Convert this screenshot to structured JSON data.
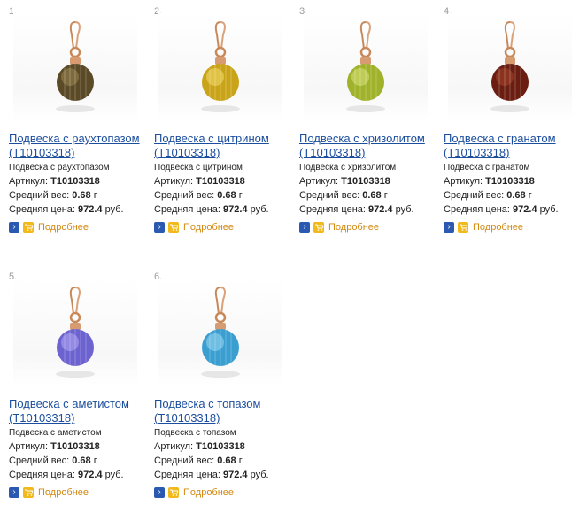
{
  "labels": {
    "article": "Артикул:",
    "weight": "Средний вес:",
    "price": "Средняя цена:",
    "more": "Подробнее"
  },
  "products": [
    {
      "num": "1.",
      "title": "Подвеска с раухтопазом (T10103318)",
      "desc": "Подвеска с раухтопазом",
      "article": "T10103318",
      "weight": "0.68",
      "weight_unit": "г",
      "price": "972.4",
      "currency": "руб.",
      "stone_color": "#5b4a26",
      "stone_light": "#9a8650"
    },
    {
      "num": "2.",
      "title": "Подвеска с цитрином (T10103318)",
      "desc": "Подвеска с цитрином",
      "article": "T10103318",
      "weight": "0.68",
      "weight_unit": "г",
      "price": "972.4",
      "currency": "руб.",
      "stone_color": "#c9a418",
      "stone_light": "#f2dc6a"
    },
    {
      "num": "3.",
      "title": "Подвеска с хризолитом (T10103318)",
      "desc": "Подвеска с хризолитом",
      "article": "T10103318",
      "weight": "0.68",
      "weight_unit": "г",
      "price": "972.4",
      "currency": "руб.",
      "stone_color": "#9fb22a",
      "stone_light": "#d8e47c"
    },
    {
      "num": "4.",
      "title": "Подвеска с гранатом (T10103318)",
      "desc": "Подвеска с гранатом",
      "article": "T10103318",
      "weight": "0.68",
      "weight_unit": "г",
      "price": "972.4",
      "currency": "руб.",
      "stone_color": "#6a1d10",
      "stone_light": "#a8432a"
    },
    {
      "num": "5.",
      "title": "Подвеска с аметистом (T10103318)",
      "desc": "Подвеска с аметистом",
      "article": "T10103318",
      "weight": "0.68",
      "weight_unit": "г",
      "price": "972.4",
      "currency": "руб.",
      "stone_color": "#6d63d0",
      "stone_light": "#b2acf2"
    },
    {
      "num": "6.",
      "title": "Подвеска с топазом (T10103318)",
      "desc": "Подвеска с топазом",
      "article": "T10103318",
      "weight": "0.68",
      "weight_unit": "г",
      "price": "972.4",
      "currency": "руб.",
      "stone_color": "#3a9ed0",
      "stone_light": "#9bd8f2"
    }
  ]
}
